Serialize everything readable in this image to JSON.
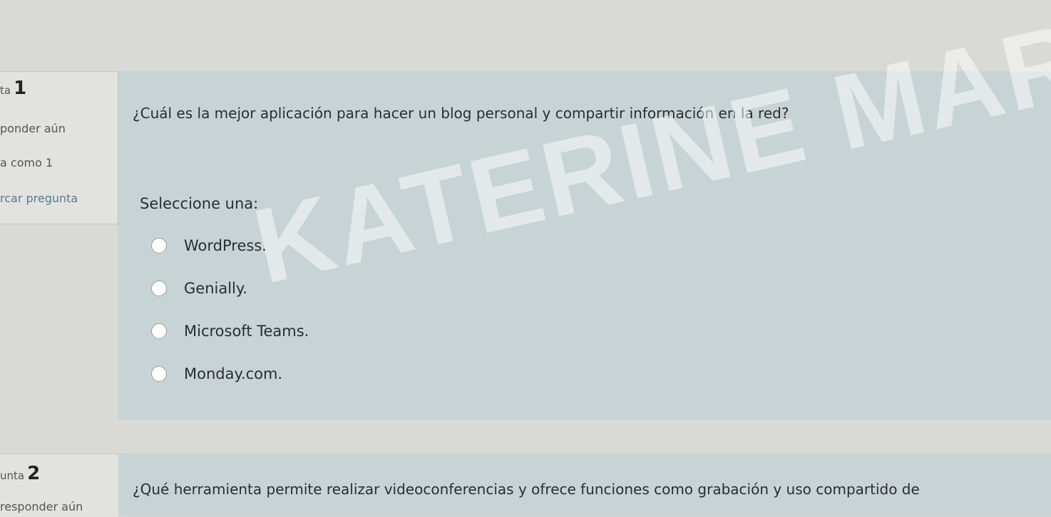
{
  "question1": {
    "info": {
      "label": "ta",
      "number": "1",
      "status": "ponder aún",
      "mark": "a como 1",
      "flag": "rcar pregunta"
    },
    "text": "¿Cuál es la mejor aplicación para hacer un blog personal y compartir información en la red?",
    "prompt": "Seleccione una:",
    "options": [
      "WordPress.",
      "Genially.",
      "Microsoft Teams.",
      "Monday.com."
    ],
    "watermark": "KATERINE MARCELA"
  },
  "question2": {
    "info": {
      "label": "unta",
      "number": "2",
      "status": "responder aún"
    },
    "text": "¿Qué herramienta permite realizar videoconferencias y ofrece funciones como grabación y uso compartido de"
  }
}
